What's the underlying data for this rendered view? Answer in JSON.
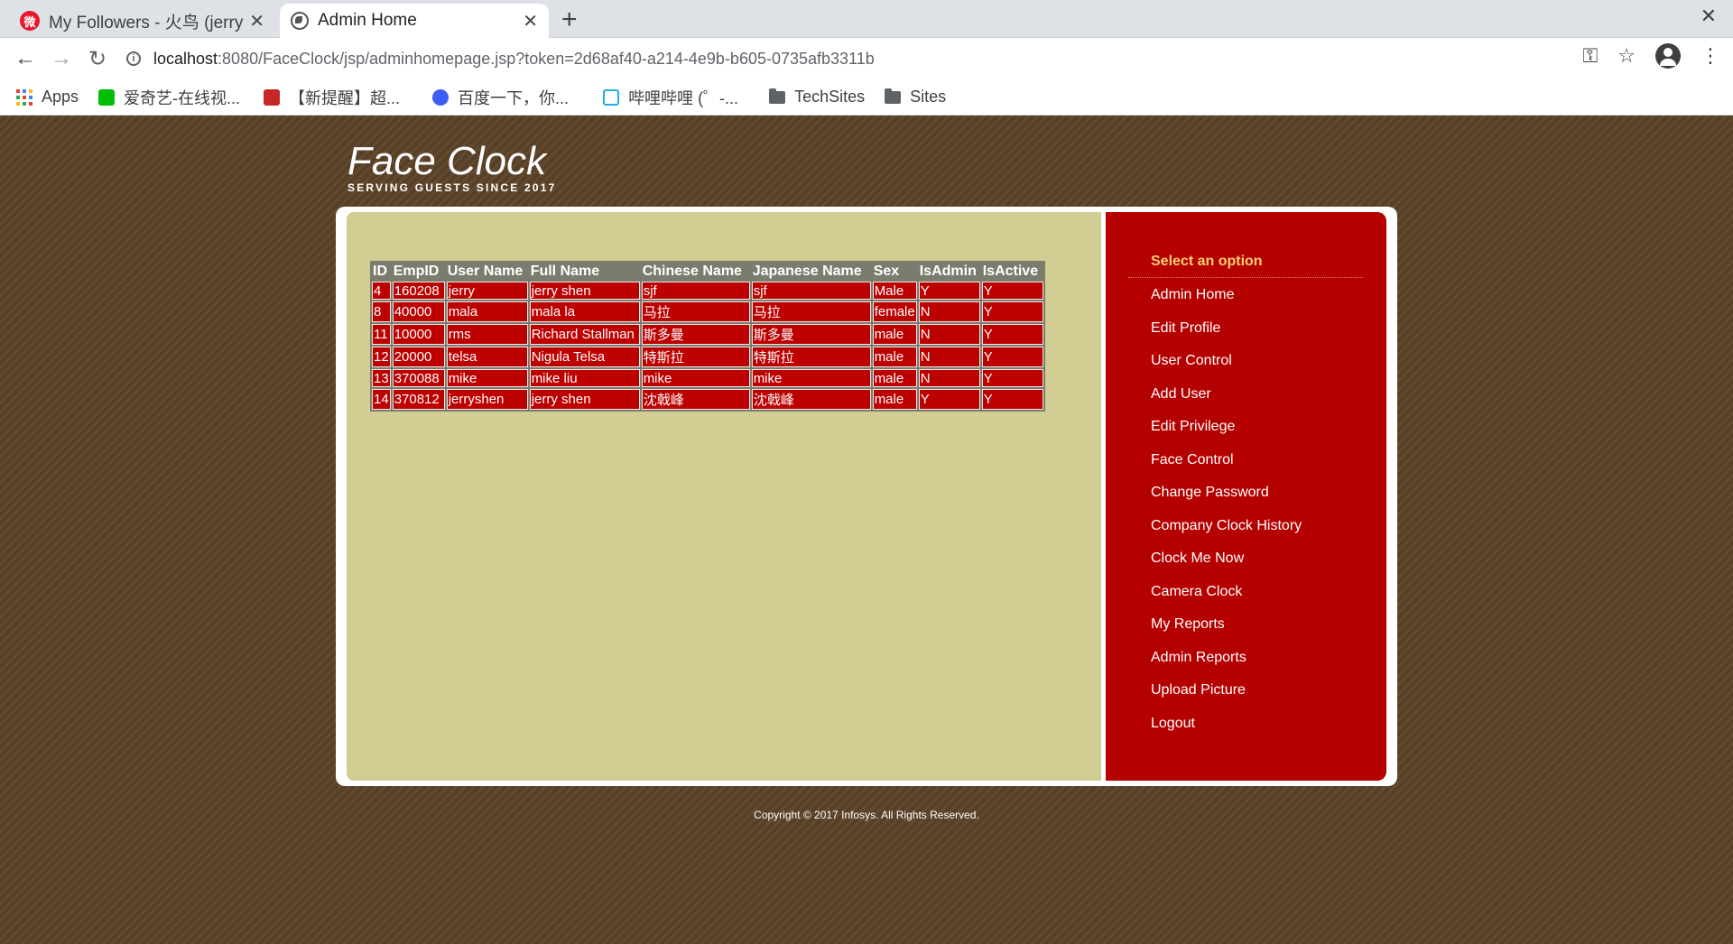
{
  "browser": {
    "tabs": [
      {
        "title": "My Followers - 火鸟 (jerry",
        "active": false
      },
      {
        "title": "Admin Home",
        "active": true
      }
    ],
    "url_host": "localhost",
    "url_rest": ":8080/FaceClock/jsp/adminhomepage.jsp?token=2d68af40-a214-4e9b-b605-0735afb3311b",
    "bookmarks": [
      {
        "label": "Apps",
        "icon": "apps-grid-icon"
      },
      {
        "label": "爱奇艺-在线视...",
        "icon": "iqiyi-icon"
      },
      {
        "label": "【新提醒】超...",
        "icon": "forum-icon"
      },
      {
        "label": "百度一下，你...",
        "icon": "baidu-paw-icon"
      },
      {
        "label": "哔哩哔哩 (゜-...",
        "icon": "bilibili-icon"
      },
      {
        "label": "TechSites",
        "icon": "folder-icon"
      },
      {
        "label": "Sites",
        "icon": "folder-icon"
      }
    ]
  },
  "site": {
    "title": "Face Clock",
    "tagline": "SERVING GUESTS SINCE 2017"
  },
  "table": {
    "headers": [
      "ID",
      "EmpID",
      "User Name",
      "Full Name",
      "Chinese Name",
      "Japanese Name",
      "Sex",
      "IsAdmin",
      "IsActive"
    ],
    "rows": [
      [
        "4",
        "160208",
        "jerry",
        "jerry shen",
        "sjf",
        "sjf",
        "Male",
        "Y",
        "Y"
      ],
      [
        "8",
        "40000",
        "mala",
        "mala la",
        "马拉",
        "马拉",
        "female",
        "N",
        "Y"
      ],
      [
        "11",
        "10000",
        "rms",
        "Richard Stallman",
        "斯多曼",
        "斯多曼",
        "male",
        "N",
        "Y"
      ],
      [
        "12",
        "20000",
        "telsa",
        "Nigula Telsa",
        "特斯拉",
        "特斯拉",
        "male",
        "N",
        "Y"
      ],
      [
        "13",
        "370088",
        "mike",
        "mike liu",
        "mike",
        "mike",
        "male",
        "N",
        "Y"
      ],
      [
        "14",
        "370812",
        "jerryshen",
        "jerry shen",
        "沈戟峰",
        "沈戟峰",
        "male",
        "Y",
        "Y"
      ]
    ]
  },
  "sidebar": {
    "heading": "Select an option",
    "items": [
      "Admin Home",
      "Edit Profile",
      "User Control",
      "Add User",
      "Edit Privilege",
      "Face Control",
      "Change Password",
      "Company Clock History",
      "Clock Me Now",
      "Camera Clock",
      "My Reports",
      "Admin Reports",
      "Upload Picture",
      "Logout"
    ]
  },
  "footer": "Copyright © 2017 Infosys. All Rights Reserved.",
  "colors": {
    "background_brown": "#5c4329",
    "content_khaki": "#d1cd93",
    "sidebar_red": "#b50000",
    "cell_red": "#bd0000",
    "heading_gold": "#f7cf72"
  }
}
